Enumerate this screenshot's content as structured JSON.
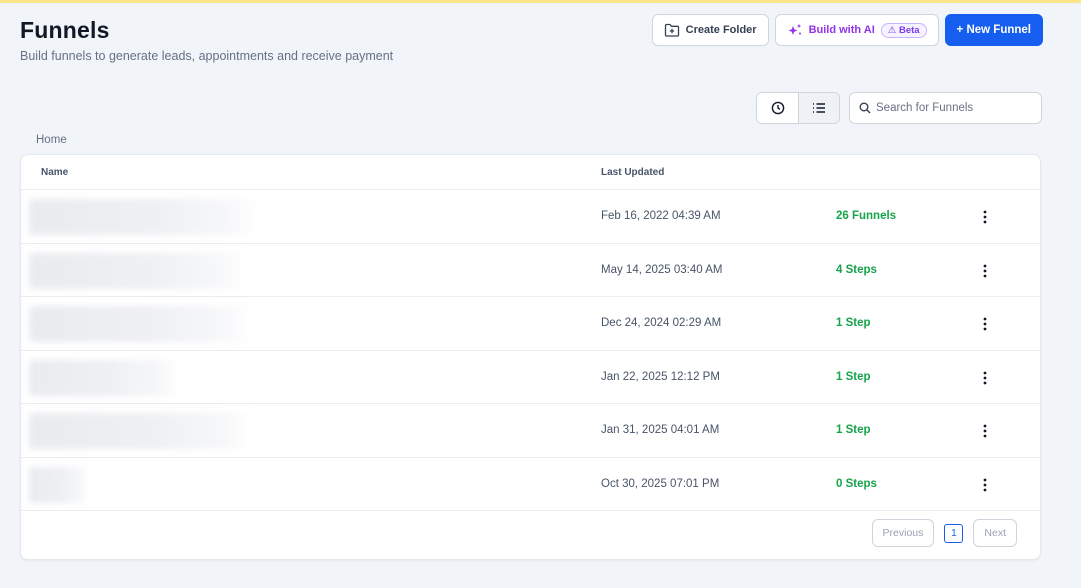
{
  "header": {
    "title": "Funnels",
    "subtitle": "Build funnels to generate leads, appointments and receive payment"
  },
  "actions": {
    "create_folder": "Create Folder",
    "build_ai": "Build with AI",
    "beta": "Beta",
    "new_funnel": "+ New Funnel"
  },
  "search": {
    "placeholder": "Search for Funnels"
  },
  "breadcrumb": "Home",
  "table": {
    "columns": {
      "name": "Name",
      "last_updated": "Last Updated"
    },
    "rows": [
      {
        "name": "",
        "last_updated": "Feb 16, 2022 04:39 AM",
        "count": "26 Funnels"
      },
      {
        "name": "",
        "last_updated": "May 14, 2025 03:40 AM",
        "count": "4 Steps"
      },
      {
        "name": "",
        "last_updated": "Dec 24, 2024 02:29 AM",
        "count": "1 Step"
      },
      {
        "name": "",
        "last_updated": "Jan 22, 2025 12:12 PM",
        "count": "1 Step"
      },
      {
        "name": "",
        "last_updated": "Jan 31, 2025 04:01 AM",
        "count": "1 Step"
      },
      {
        "name": "",
        "last_updated": "Oct 30, 2025 07:01 PM",
        "count": "0 Steps"
      }
    ]
  },
  "pagination": {
    "previous": "Previous",
    "current_page": "1",
    "next": "Next"
  },
  "icons": {
    "create_folder": "folder-plus-icon",
    "build_ai": "sparkles-icon",
    "beta": "flask-icon",
    "recent_view": "clock-icon",
    "list_view": "list-icon",
    "search": "search-icon",
    "row_menu": "kebab-menu-icon"
  },
  "colors": {
    "primary": "#155eef",
    "ai_accent": "#9333ea",
    "success": "#16a34a",
    "background": "#f1f5f9"
  }
}
